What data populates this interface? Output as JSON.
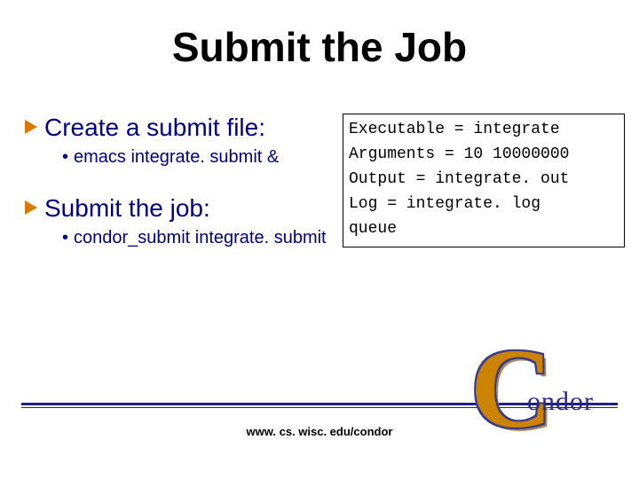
{
  "title": "Submit the Job",
  "items": [
    {
      "label": "Create a submit file:",
      "sub": "emacs integrate. submit &"
    },
    {
      "label": "Submit the job:",
      "sub": "condor_submit integrate. submit"
    }
  ],
  "code": {
    "l1": "Executable = integrate",
    "l2": "Arguments = 10 10000000",
    "l3": "Output = integrate. out",
    "l4": "Log = integrate. log",
    "l5": "queue"
  },
  "footer": "www. cs. wisc. edu/condor",
  "logo": {
    "c": "C",
    "rest": "ondor"
  }
}
